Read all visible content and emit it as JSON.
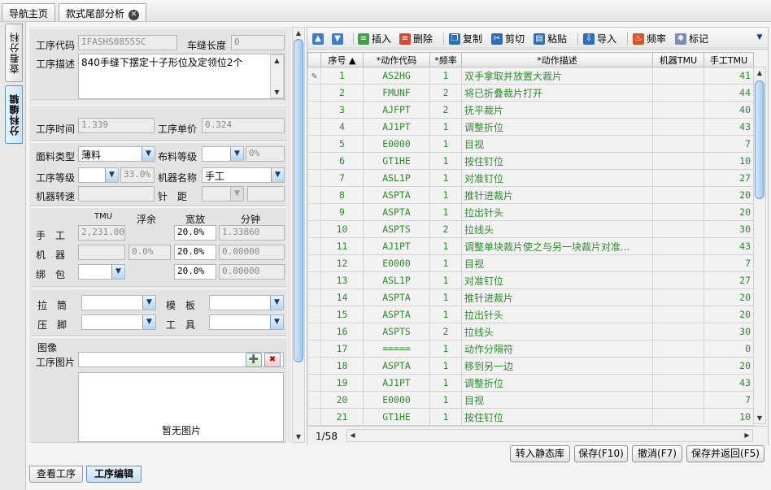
{
  "tabs": [
    {
      "label": "导航主页"
    },
    {
      "label": "款式尾部分析"
    }
  ],
  "side_tabs": [
    {
      "label": "查看分科"
    },
    {
      "label": "分科编辑"
    }
  ],
  "form": {
    "code_label": "工序代码",
    "code_value": "IFASHS08555C",
    "seam_label": "车缝长度",
    "seam_value": "0",
    "desc_label": "工序描述",
    "desc_value": "840手缝下摆定十子形位及定领位2个",
    "time_label": "工序时间",
    "time_value": "1.339",
    "price_label": "工序单价",
    "price_value": "0.324",
    "fabric_type_label": "面料类型",
    "fabric_type_value": "薄料",
    "fabric_grade_label": "布料等级",
    "fabric_grade_pct": "0%",
    "level_label": "工序等级",
    "level_pct": "33.0%",
    "machine_label": "机器名称",
    "machine_value": "手工",
    "speed_label": "机器转速",
    "needle_label": "针　距",
    "col_tmu": "TMU",
    "col_float": "浮余",
    "col_allow": "宽放",
    "col_minute": "分钟",
    "hand_label": "手　工",
    "hand_tmu": "2,231.00",
    "hand_allow": "20.0%",
    "hand_min": "1.33860",
    "mach_label": "机　器",
    "mach_float": "0.0%",
    "mach_allow": "20.0%",
    "mach_min": "0.00000",
    "bind_label": "绑　包",
    "bind_allow": "20.0%",
    "bind_min": "0.00000",
    "puller_label": "拉　筒",
    "mold_label": "模　板",
    "presser_label": "压　脚",
    "tool_label": "工　具",
    "image_label": "图像",
    "image_pic_label": "工序图片",
    "no_image": "暂无图片"
  },
  "toolbar": [
    {
      "label": "",
      "icon": "arrow-up"
    },
    {
      "label": "",
      "icon": "arrow-down"
    },
    {
      "label": "插入",
      "icon": "insert"
    },
    {
      "label": "删除",
      "icon": "delete"
    },
    {
      "label": "复制",
      "icon": "copy"
    },
    {
      "label": "剪切",
      "icon": "cut"
    },
    {
      "label": "粘贴",
      "icon": "paste"
    },
    {
      "label": "导入",
      "icon": "import"
    },
    {
      "label": "频率",
      "icon": "frequency"
    },
    {
      "label": "标记",
      "icon": "mark"
    }
  ],
  "grid": {
    "headers": [
      "序号 ▲",
      "*动作代码",
      "*频率",
      "*动作描述",
      "机器TMU",
      "手工TMU"
    ],
    "rows": [
      [
        "1",
        "AS2HG",
        "1",
        "双手拿取并放置大裁片",
        "",
        "41"
      ],
      [
        "2",
        "FMUNF",
        "2",
        "将已折叠裁片打开",
        "",
        "44"
      ],
      [
        "3",
        "AJFPT",
        "2",
        "抚平裁片",
        "",
        "40"
      ],
      [
        "4",
        "AJ1PT",
        "1",
        "调整折位",
        "",
        "43"
      ],
      [
        "5",
        "E0000",
        "1",
        "目视",
        "",
        "7"
      ],
      [
        "6",
        "GT1HE",
        "1",
        "按住钉位",
        "",
        "10"
      ],
      [
        "7",
        "ASL1P",
        "1",
        "对准钉位",
        "",
        "27"
      ],
      [
        "8",
        "ASPTA",
        "1",
        "推针进裁片",
        "",
        "20"
      ],
      [
        "9",
        "ASPTA",
        "1",
        "拉出针头",
        "",
        "20"
      ],
      [
        "10",
        "ASPTS",
        "2",
        "拉线头",
        "",
        "30"
      ],
      [
        "11",
        "AJ1PT",
        "1",
        "调整单块裁片使之与另一块裁片对准...",
        "",
        "43"
      ],
      [
        "12",
        "E0000",
        "1",
        "目视",
        "",
        "7"
      ],
      [
        "13",
        "ASL1P",
        "1",
        "对准钉位",
        "",
        "27"
      ],
      [
        "14",
        "ASPTA",
        "1",
        "推针进裁片",
        "",
        "20"
      ],
      [
        "15",
        "ASPTA",
        "1",
        "拉出针头",
        "",
        "20"
      ],
      [
        "16",
        "ASPTS",
        "2",
        "拉线头",
        "",
        "30"
      ],
      [
        "17",
        "=====",
        "1",
        "动作分隔符",
        "",
        "0"
      ],
      [
        "18",
        "ASPTA",
        "1",
        "移到另一边",
        "",
        "20"
      ],
      [
        "19",
        "AJ1PT",
        "1",
        "调整折位",
        "",
        "43"
      ],
      [
        "20",
        "E0000",
        "1",
        "目视",
        "",
        "7"
      ],
      [
        "21",
        "GT1HE",
        "1",
        "按住钉位",
        "",
        "10"
      ]
    ],
    "pager": "1/58"
  },
  "buttons": [
    {
      "label": "转入静态库"
    },
    {
      "label": "保存(F10)"
    },
    {
      "label": "撤消(F7)"
    },
    {
      "label": "保存并返回(F5)"
    }
  ],
  "bottom_tabs": [
    {
      "label": "查看工序"
    },
    {
      "label": "工序编辑"
    }
  ]
}
